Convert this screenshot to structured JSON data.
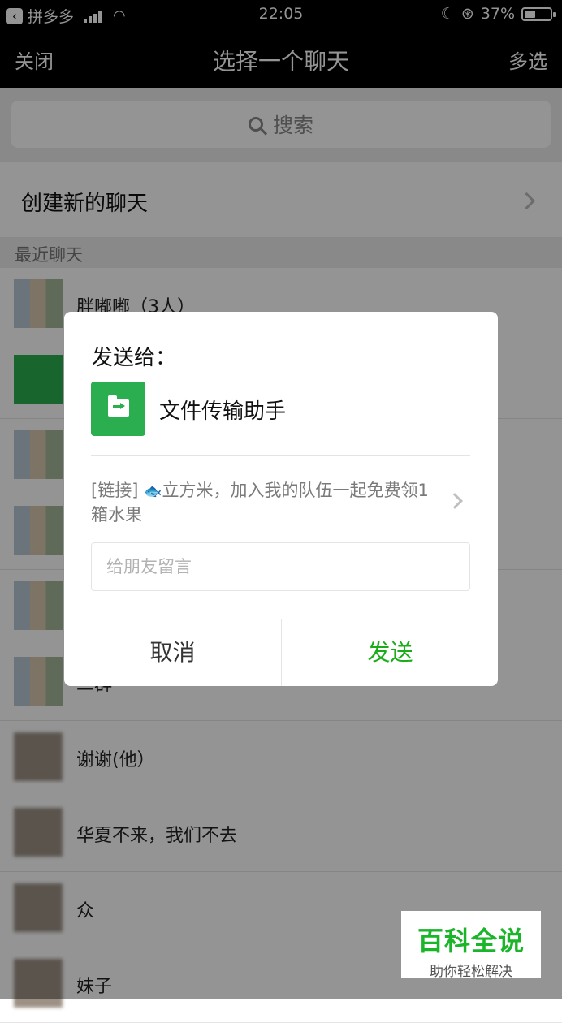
{
  "status_bar": {
    "carrier": "拼多多",
    "time": "22:05",
    "battery": "37%",
    "battery_level": 0.37
  },
  "nav": {
    "close_label": "关闭",
    "title": "选择一个聊天",
    "multi_select_label": "多选"
  },
  "search": {
    "label": "搜索"
  },
  "new_chat": {
    "label": "创建新的聊天"
  },
  "recent": {
    "label": "最近聊天",
    "chats": [
      {
        "name": "胖嘟嘟（3人）"
      },
      {
        "name": ""
      },
      {
        "name": ""
      },
      {
        "name": ""
      },
      {
        "name": ""
      },
      {
        "name": "二群"
      },
      {
        "name": "谢谢(他）"
      },
      {
        "name": "华夏不来，我们不去"
      },
      {
        "name": "众"
      },
      {
        "name": "妹子"
      }
    ]
  },
  "dialog": {
    "heading": "发送给：",
    "recipient": "文件传输助手",
    "link_prefix": "[链接]",
    "link_icon": "fish-icon",
    "link_body": "立方米，加入我的队伍一起免费领1箱水果",
    "message_placeholder": "给朋友留言",
    "cancel_label": "取消",
    "send_label": "发送",
    "send_color": "#1aad19"
  },
  "watermark": {
    "title": "百科全说",
    "subtitle": "助你轻松解决"
  }
}
